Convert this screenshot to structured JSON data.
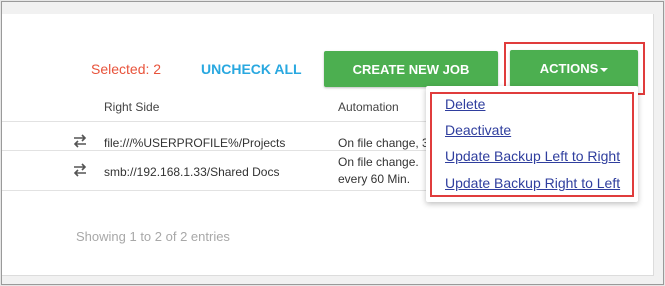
{
  "toolbar": {
    "selected_label": "Selected: 2",
    "uncheck_all": "UNCHECK ALL",
    "create_new_job": "CREATE NEW JOB",
    "actions": "ACTIONS"
  },
  "table": {
    "columns": [
      "Right Side",
      "Automation"
    ],
    "rows": [
      {
        "right_side": "file:///%USERPROFILE%/Projects",
        "automation": "On file change, 3"
      },
      {
        "right_side": "smb://192.168.1.33/Shared Docs",
        "automation_line1": "On file change.",
        "automation_line2": "every 60 Min."
      }
    ],
    "footer": "Showing 1 to 2 of 2 entries"
  },
  "actions_menu": {
    "items": [
      "Delete",
      "Deactivate",
      "Update Backup Left to Right",
      "Update Backup Right to Left"
    ]
  },
  "colors": {
    "green": "#4caf50",
    "highlight_red": "#e03c3c",
    "selected_orange": "#e8533b",
    "link_blue": "#29a8e0",
    "menu_link": "#2f3e9e"
  }
}
